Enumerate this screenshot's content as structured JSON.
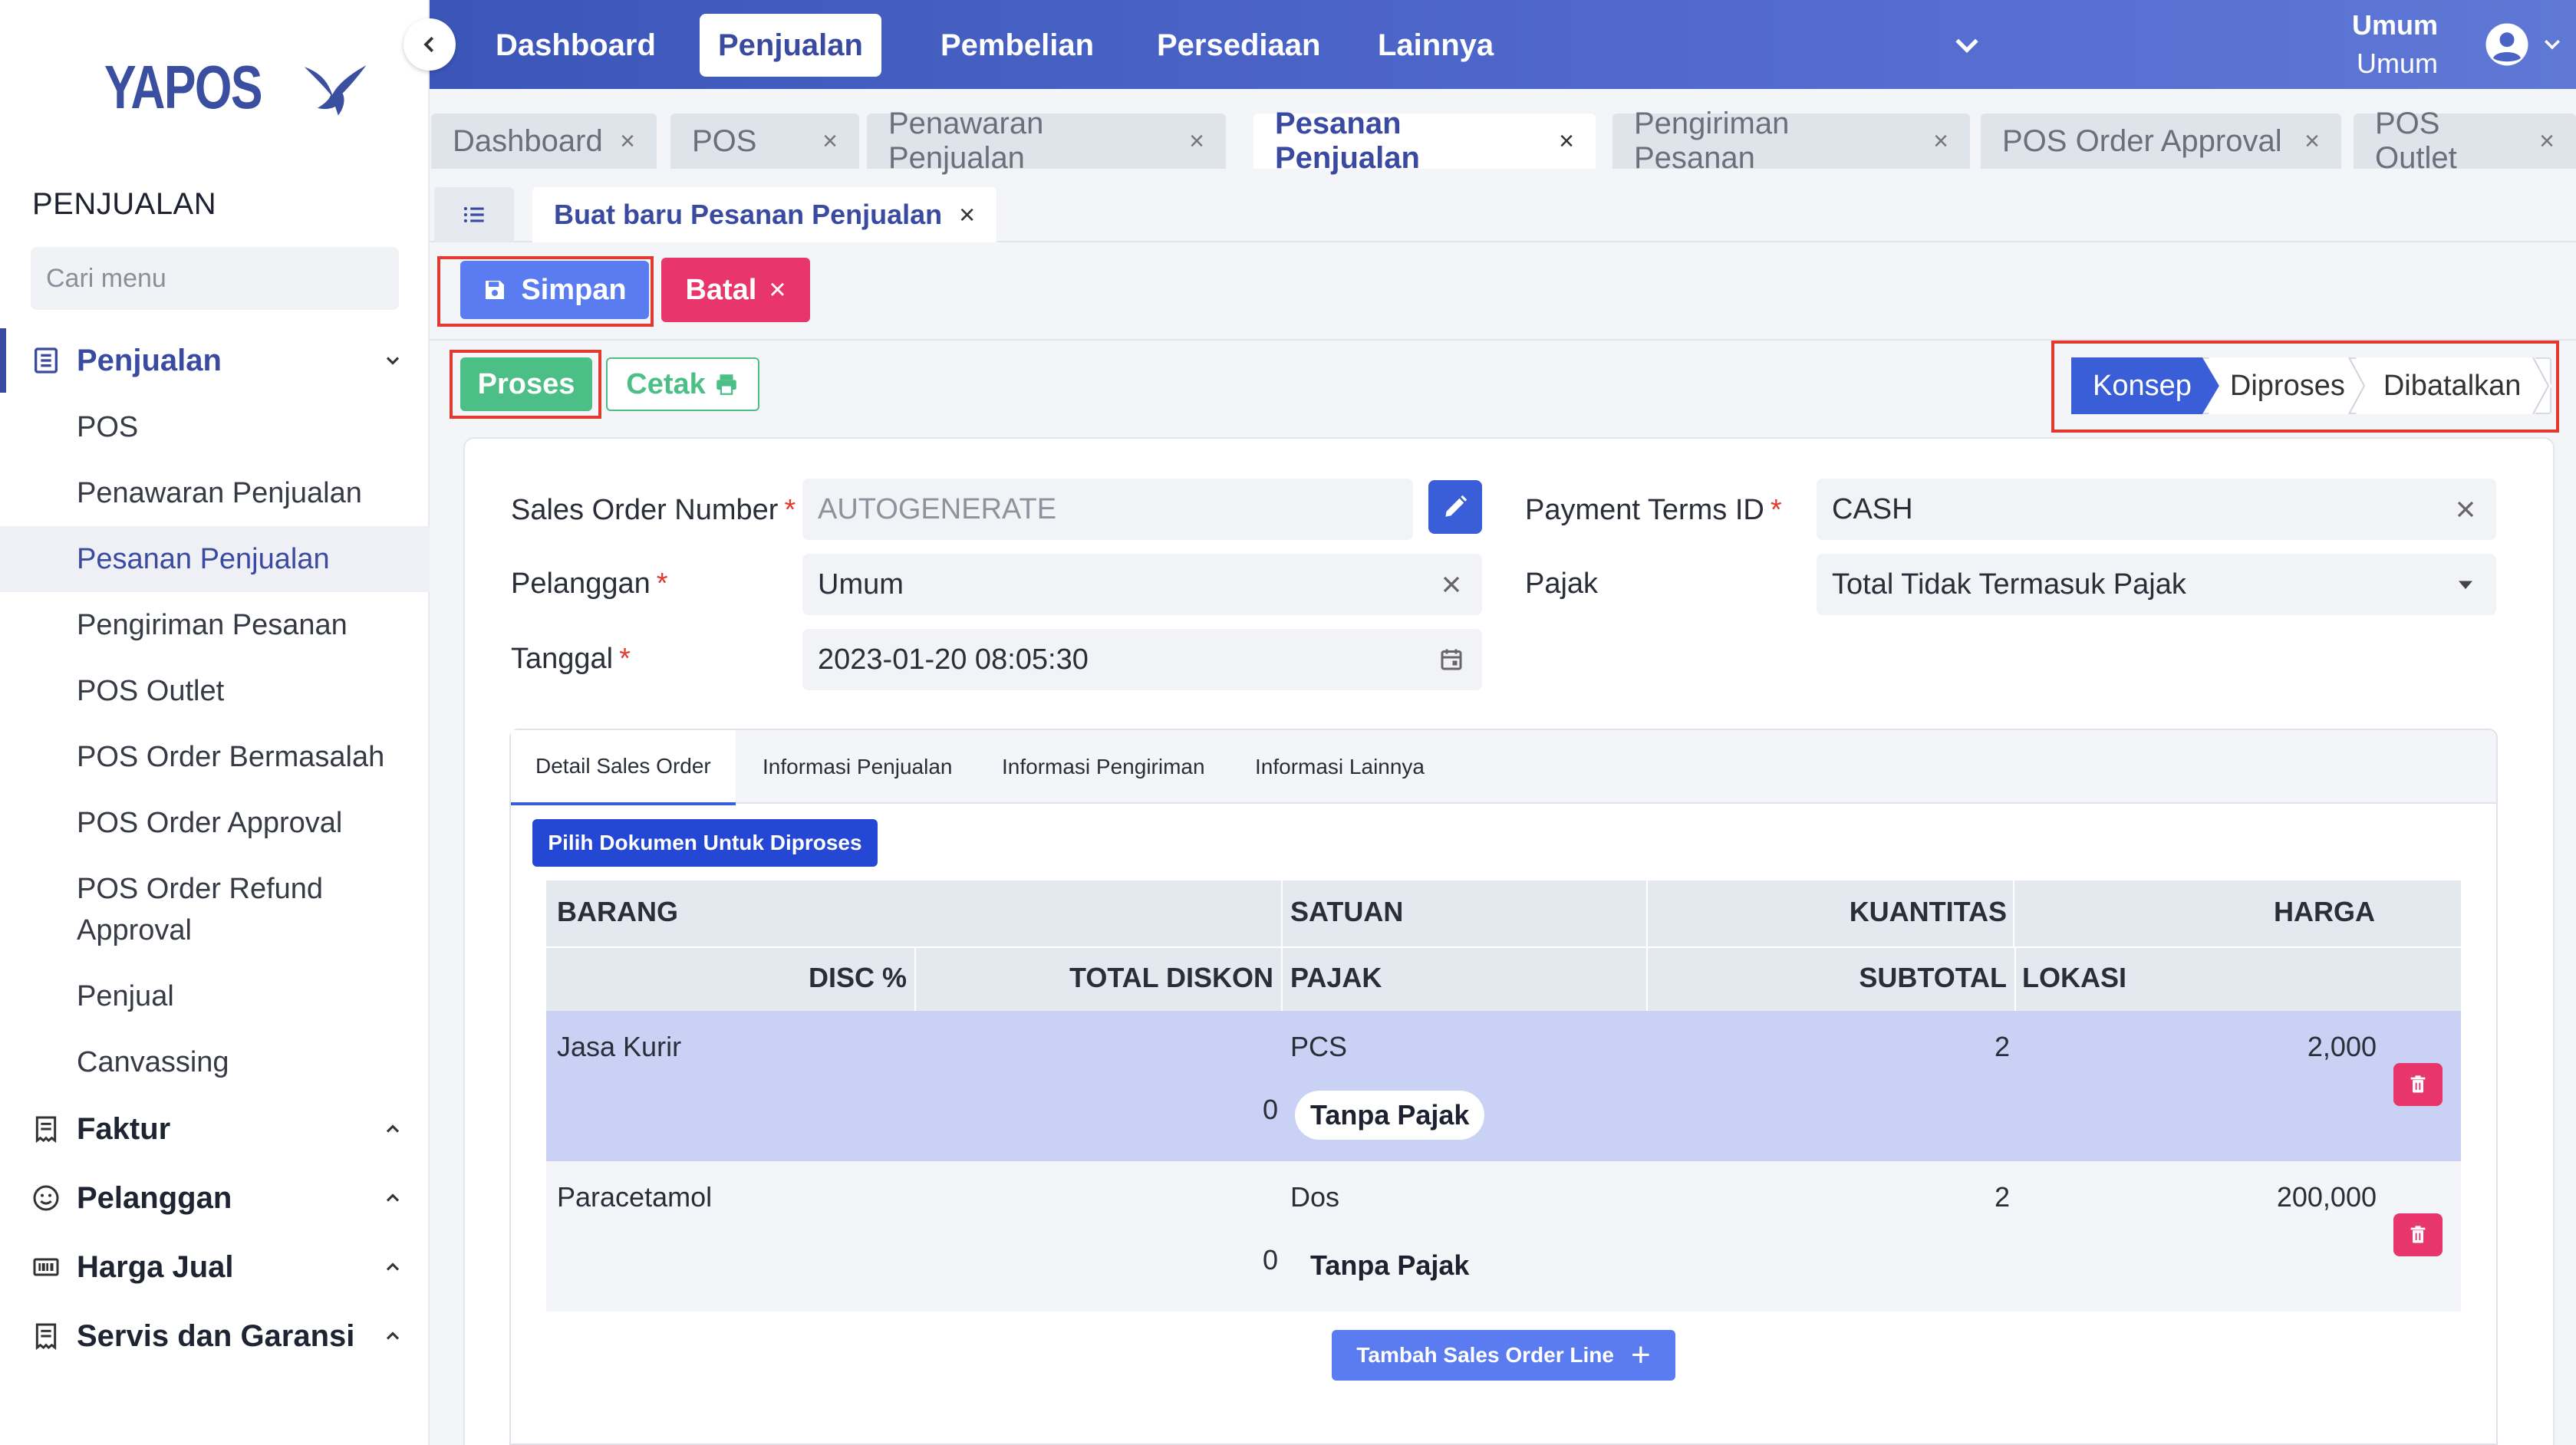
{
  "brand": {
    "name": "YAPOS"
  },
  "sidebar": {
    "section_title": "PENJUALAN",
    "search_placeholder": "Cari menu",
    "groups": [
      {
        "label": "Penjualan",
        "icon": "list-icon",
        "expanded": true
      },
      {
        "label": "Faktur",
        "icon": "receipt-icon",
        "expanded": false
      },
      {
        "label": "Pelanggan",
        "icon": "smiley-icon",
        "expanded": false
      },
      {
        "label": "Harga Jual",
        "icon": "barcode-icon",
        "expanded": false
      },
      {
        "label": "Servis dan Garansi",
        "icon": "receipt-icon",
        "expanded": false
      }
    ],
    "sub_items": [
      "POS",
      "Penawaran Penjualan",
      "Pesanan Penjualan",
      "Pengiriman Pesanan",
      "POS Outlet",
      "POS Order Bermasalah",
      "POS Order Approval",
      "POS Order Refund",
      "Approval",
      "Penjual",
      "Canvassing"
    ],
    "active_sub_item": "Pesanan Penjualan"
  },
  "topbar": {
    "nav": [
      "Dashboard",
      "Penjualan",
      "Pembelian",
      "Persediaan",
      "Lainnya"
    ],
    "active_nav": "Penjualan",
    "user_name": "Umum",
    "user_sub": "Umum"
  },
  "tabs": [
    {
      "label": "Dashboard",
      "close": "×"
    },
    {
      "label": "POS",
      "close": "×"
    },
    {
      "label": "Penawaran Penjualan",
      "close": "×"
    },
    {
      "label": "Pesanan Penjualan",
      "close": "×",
      "active": true
    },
    {
      "label": "Pengiriman Pesanan",
      "close": "×"
    },
    {
      "label": "POS Order Approval",
      "close": "×"
    },
    {
      "label": "POS Outlet",
      "close": "×"
    }
  ],
  "doc_tab": {
    "label": "Buat baru Pesanan Penjualan",
    "close": "×"
  },
  "toolbar": {
    "save_label": "Simpan",
    "cancel_label": "Batal",
    "cancel_icon": "×",
    "process_label": "Proses",
    "print_label": "Cetak"
  },
  "status_steps": {
    "items": [
      "Konsep",
      "Diproses",
      "Dibatalkan"
    ],
    "current": "Konsep"
  },
  "form": {
    "sales_order_number": {
      "label": "Sales Order Number",
      "placeholder": "AUTOGENERATE",
      "required": "*"
    },
    "customer": {
      "label": "Pelanggan",
      "value": "Umum",
      "required": "*"
    },
    "date": {
      "label": "Tanggal",
      "value": "2023-01-20  08:05:30",
      "required": "*"
    },
    "payment_terms": {
      "label": "Payment Terms ID",
      "value": "CASH",
      "required": "*"
    },
    "tax": {
      "label": "Pajak",
      "value": "Total Tidak Termasuk Pajak"
    }
  },
  "inner_tabs": [
    "Detail Sales Order",
    "Informasi Penjualan",
    "Informasi Pengiriman",
    "Informasi Lainnya"
  ],
  "active_inner_tab": "Detail Sales Order",
  "select_doc_button": "Pilih Dokumen Untuk Diproses",
  "table": {
    "headers_row1": [
      "BARANG",
      "SATUAN",
      "KUANTITAS",
      "HARGA"
    ],
    "headers_row2": [
      "DISC %",
      "TOTAL DISKON",
      "PAJAK",
      "SUBTOTAL",
      "LOKASI"
    ],
    "rows": [
      {
        "item": "Jasa Kurir",
        "unit": "PCS",
        "qty": "2",
        "price": "2,000",
        "total_discount": "0",
        "tax": "Tanpa Pajak",
        "selected": true
      },
      {
        "item": "Paracetamol",
        "unit": "Dos",
        "qty": "2",
        "price": "200,000",
        "total_discount": "0",
        "tax": "Tanpa Pajak",
        "selected": false
      }
    ]
  },
  "add_line_button": "Tambah Sales Order Line",
  "add_line_icon": "+",
  "colors": {
    "primary": "#3a5ed8",
    "danger": "#e8356b",
    "success": "#4cbf86",
    "topbar": "#4a63c4",
    "highlight": "#e23a2f"
  }
}
